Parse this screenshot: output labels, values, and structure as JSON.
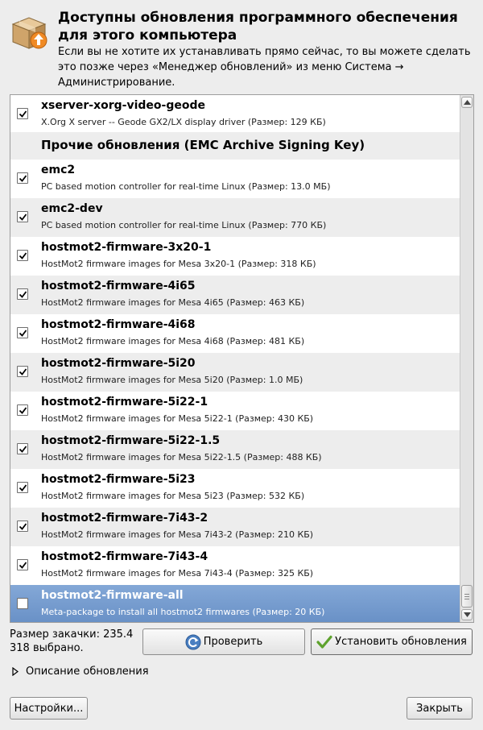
{
  "header": {
    "title": "Доступны обновления программного обеспечения для этого компьютера",
    "description": "Если вы не хотите их устанавливать прямо сейчас, то вы можете сделать это позже через «Менеджер обновлений» из меню Система → Администрирование."
  },
  "updates": {
    "first": {
      "name": "xserver-xorg-video-geode",
      "desc": "X.Org X server -- Geode GX2/LX display driver (Размер: 129 КБ)",
      "checked": true
    },
    "group_title": "Прочие обновления (EMC Archive Signing Key)",
    "items": [
      {
        "name": "emc2",
        "desc": "PC based motion controller for real-time Linux (Размер: 13.0 МБ)",
        "checked": true
      },
      {
        "name": "emc2-dev",
        "desc": "PC based motion controller for real-time Linux (Размер: 770 КБ)",
        "checked": true
      },
      {
        "name": "hostmot2-firmware-3x20-1",
        "desc": "HostMot2 firmware images for Mesa 3x20-1 (Размер: 318 КБ)",
        "checked": true
      },
      {
        "name": "hostmot2-firmware-4i65",
        "desc": "HostMot2 firmware images for Mesa 4i65 (Размер: 463 КБ)",
        "checked": true
      },
      {
        "name": "hostmot2-firmware-4i68",
        "desc": "HostMot2 firmware images for Mesa 4i68 (Размер: 481 КБ)",
        "checked": true
      },
      {
        "name": "hostmot2-firmware-5i20",
        "desc": "HostMot2 firmware images for Mesa 5i20 (Размер: 1.0 МБ)",
        "checked": true
      },
      {
        "name": "hostmot2-firmware-5i22-1",
        "desc": "HostMot2 firmware images for Mesa 5i22-1 (Размер: 430 КБ)",
        "checked": true
      },
      {
        "name": "hostmot2-firmware-5i22-1.5",
        "desc": "HostMot2 firmware images for Mesa 5i22-1.5 (Размер: 488 КБ)",
        "checked": true
      },
      {
        "name": "hostmot2-firmware-5i23",
        "desc": "HostMot2 firmware images for Mesa 5i23 (Размер: 532 КБ)",
        "checked": true
      },
      {
        "name": "hostmot2-firmware-7i43-2",
        "desc": "HostMot2 firmware images for Mesa 7i43-2 (Размер: 210 КБ)",
        "checked": true
      },
      {
        "name": "hostmot2-firmware-7i43-4",
        "desc": "HostMot2 firmware images for Mesa 7i43-4 (Размер: 325 КБ)",
        "checked": true
      },
      {
        "name": "hostmot2-firmware-all",
        "desc": "Meta-package to install all hostmot2 firmwares (Размер: 20 КБ)",
        "checked": false,
        "selected": true
      }
    ]
  },
  "footer": {
    "download_size": "Размер закачки: 235.4 318 выбрано.",
    "check_label": "Проверить",
    "install_label": "Установить обновления",
    "description_expander": "Описание обновления",
    "settings_label": "Настройки...",
    "close_label": "Закрыть"
  },
  "colors": {
    "selection": "#6f96ca",
    "window_bg": "#ededed",
    "alt_row": "#ededed"
  },
  "icons": {
    "header": "package-update-icon",
    "check": "refresh-icon",
    "install": "checkmark-icon",
    "expander": "triangle-right-icon"
  }
}
